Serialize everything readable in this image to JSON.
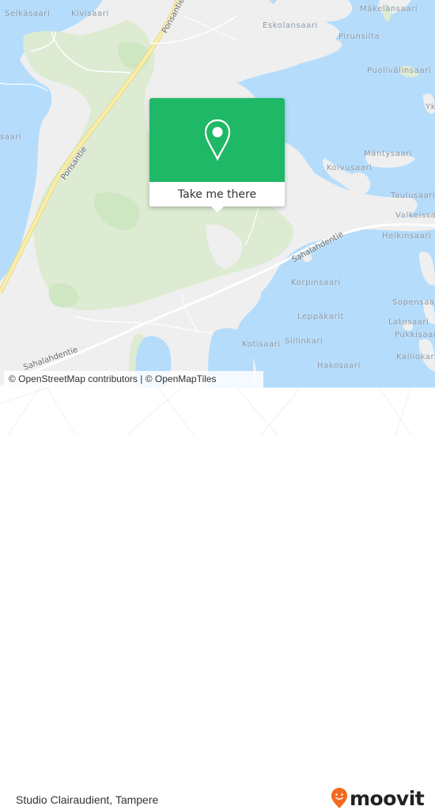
{
  "map": {
    "colors": {
      "water": "#b5dcfb",
      "land": "#efefef",
      "forest": "#dcebd2",
      "forest_dark": "#cfe6c2",
      "major_road": "#f6e79a",
      "minor_road": "#ffffff"
    },
    "place_labels": [
      {
        "name": "Selkäsaari"
      },
      {
        "name": "Kivisaari"
      },
      {
        "name": "Mäkelänsaari"
      },
      {
        "name": "Eskolansaari"
      },
      {
        "name": "Pirunsilta"
      },
      {
        "name": "Puolivälinsaari"
      },
      {
        "name": "Yk"
      },
      {
        "name": "saari"
      },
      {
        "name": "Mäntysaari"
      },
      {
        "name": "Koivusaari"
      },
      {
        "name": "Taulusaari"
      },
      {
        "name": "Valkeissaari"
      },
      {
        "name": "Heikinsaari"
      },
      {
        "name": "Korpinsaari"
      },
      {
        "name": "Sopensaari"
      },
      {
        "name": "Leppäkarit"
      },
      {
        "name": "Latosaari"
      },
      {
        "name": "Pukkisaari"
      },
      {
        "name": "Kotisaari"
      },
      {
        "name": "Siilinkari"
      },
      {
        "name": "Kalliokari"
      },
      {
        "name": "Hakosaari"
      }
    ],
    "road_labels": [
      {
        "name": "Ponsantie"
      },
      {
        "name": "Ponsantie"
      },
      {
        "name": "Sahalahdentie"
      },
      {
        "name": "Sahalahdentie"
      }
    ],
    "popup": {
      "icon": "map-pin-icon",
      "action_label": "Take me there",
      "accent_color": "#1fb866"
    },
    "attribution": "© OpenStreetMap contributors | © OpenMapTiles"
  },
  "footer": {
    "place_title": "Studio Clairaudient, Tampere",
    "brand": {
      "name": "moovit",
      "icon": "moovit-smiley-pin-icon",
      "color": "#f26b21"
    }
  }
}
